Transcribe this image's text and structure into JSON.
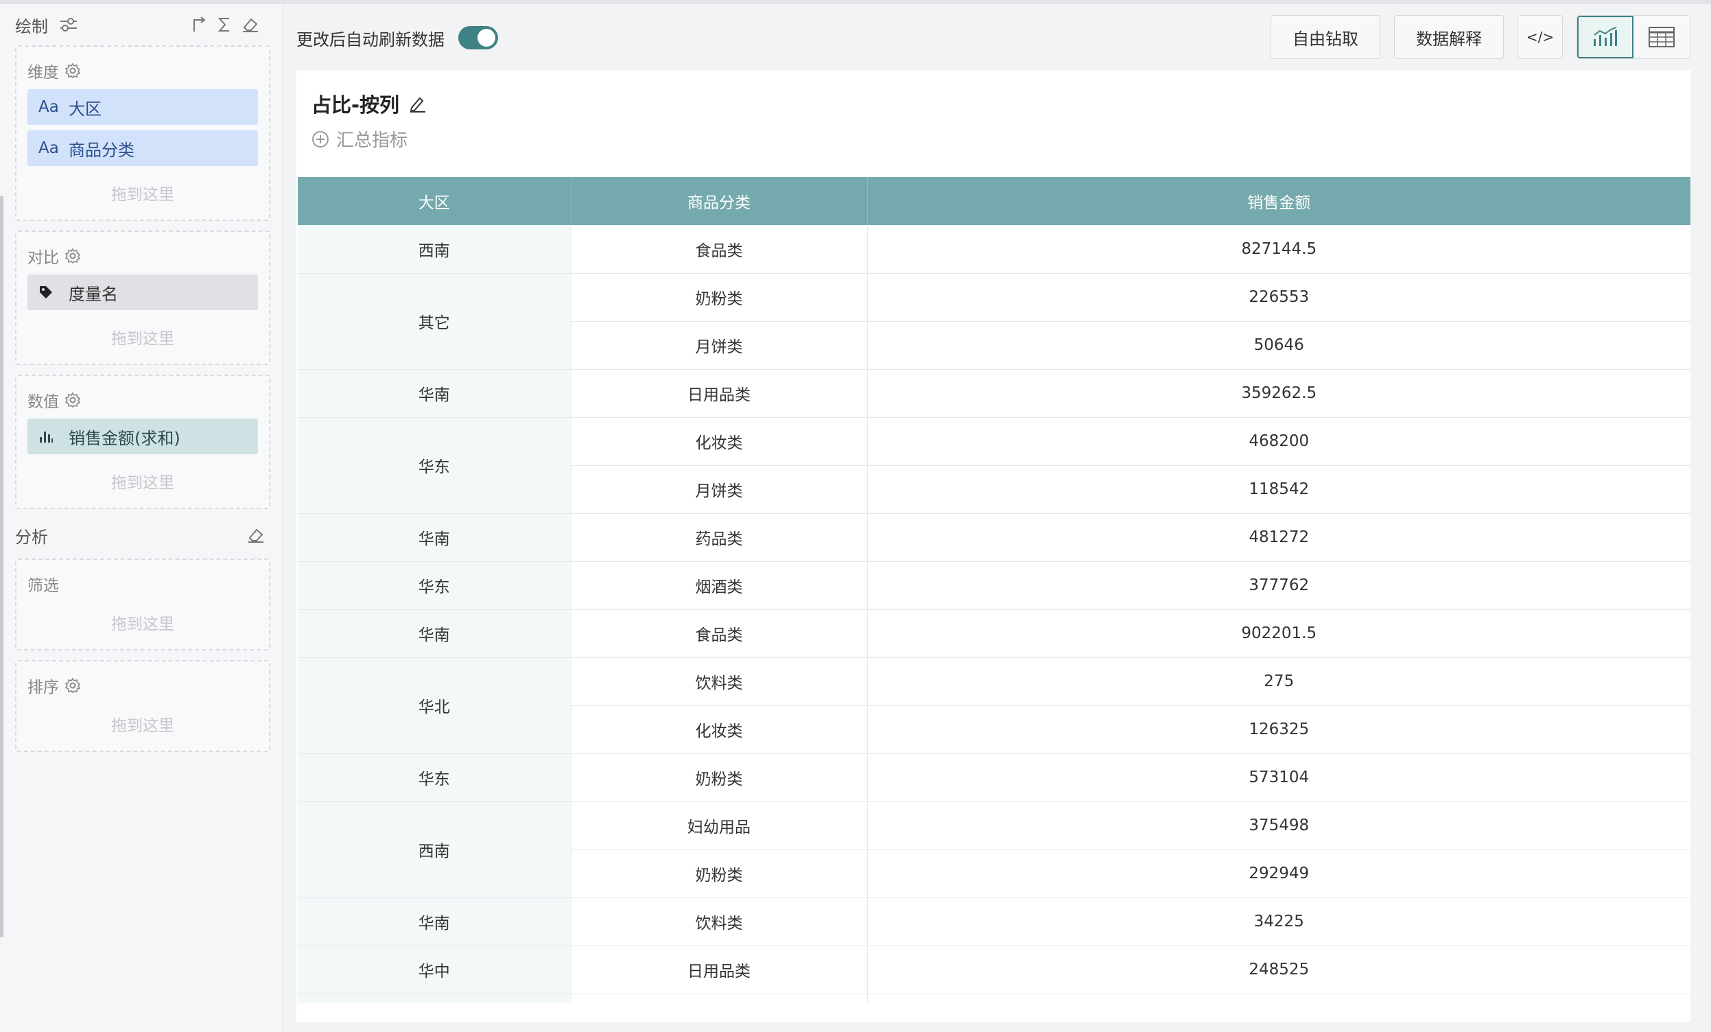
{
  "left_panel": {
    "title": "绘制",
    "dimension": {
      "title": "维度",
      "items": [
        {
          "icon": "Aa",
          "label": "大区"
        },
        {
          "icon": "Aa",
          "label": "商品分类"
        }
      ],
      "drop_hint": "拖到这里"
    },
    "compare": {
      "title": "对比",
      "items": [
        {
          "icon": "tag-icon",
          "label": "度量名"
        }
      ],
      "drop_hint": "拖到这里"
    },
    "value": {
      "title": "数值",
      "items": [
        {
          "icon": "bar-chart-icon",
          "label": "销售金额(求和)"
        }
      ],
      "drop_hint": "拖到这里"
    },
    "analysis": {
      "title": "分析",
      "filter": {
        "title": "筛选",
        "drop_hint": "拖到这里"
      },
      "sort": {
        "title": "排序",
        "drop_hint": "拖到这里"
      }
    }
  },
  "toolbar": {
    "auto_refresh_label": "更改后自动刷新数据",
    "auto_refresh_on": true,
    "drill_button": "自由钻取",
    "explain_button": "数据解释",
    "code_button": "</>"
  },
  "card": {
    "title": "占比-按列",
    "summary_label": "汇总指标"
  },
  "table": {
    "columns": [
      "大区",
      "商品分类",
      "销售金额"
    ],
    "groups": [
      {
        "region": "西南",
        "rows": [
          [
            "食品类",
            "827144.5"
          ]
        ]
      },
      {
        "region": "其它",
        "rows": [
          [
            "奶粉类",
            "226553"
          ],
          [
            "月饼类",
            "50646"
          ]
        ]
      },
      {
        "region": "华南",
        "rows": [
          [
            "日用品类",
            "359262.5"
          ]
        ]
      },
      {
        "region": "华东",
        "rows": [
          [
            "化妆类",
            "468200"
          ],
          [
            "月饼类",
            "118542"
          ]
        ]
      },
      {
        "region": "华南",
        "rows": [
          [
            "药品类",
            "481272"
          ]
        ]
      },
      {
        "region": "华东",
        "rows": [
          [
            "烟酒类",
            "377762"
          ]
        ]
      },
      {
        "region": "华南",
        "rows": [
          [
            "食品类",
            "902201.5"
          ]
        ]
      },
      {
        "region": "华北",
        "rows": [
          [
            "饮料类",
            "275"
          ],
          [
            "化妆类",
            "126325"
          ]
        ]
      },
      {
        "region": "华东",
        "rows": [
          [
            "奶粉类",
            "573104"
          ]
        ]
      },
      {
        "region": "西南",
        "rows": [
          [
            "妇幼用品",
            "375498"
          ],
          [
            "奶粉类",
            "292949"
          ]
        ]
      },
      {
        "region": "华南",
        "rows": [
          [
            "饮料类",
            "34225"
          ]
        ]
      },
      {
        "region": "华中",
        "rows": [
          [
            "日用品类",
            "248525"
          ]
        ]
      }
    ]
  },
  "colors": {
    "accent": "#3f8184",
    "header_bg": "#74a9ad",
    "dimension_pill": "#d2e2fb",
    "value_pill": "#cfe2e3"
  }
}
